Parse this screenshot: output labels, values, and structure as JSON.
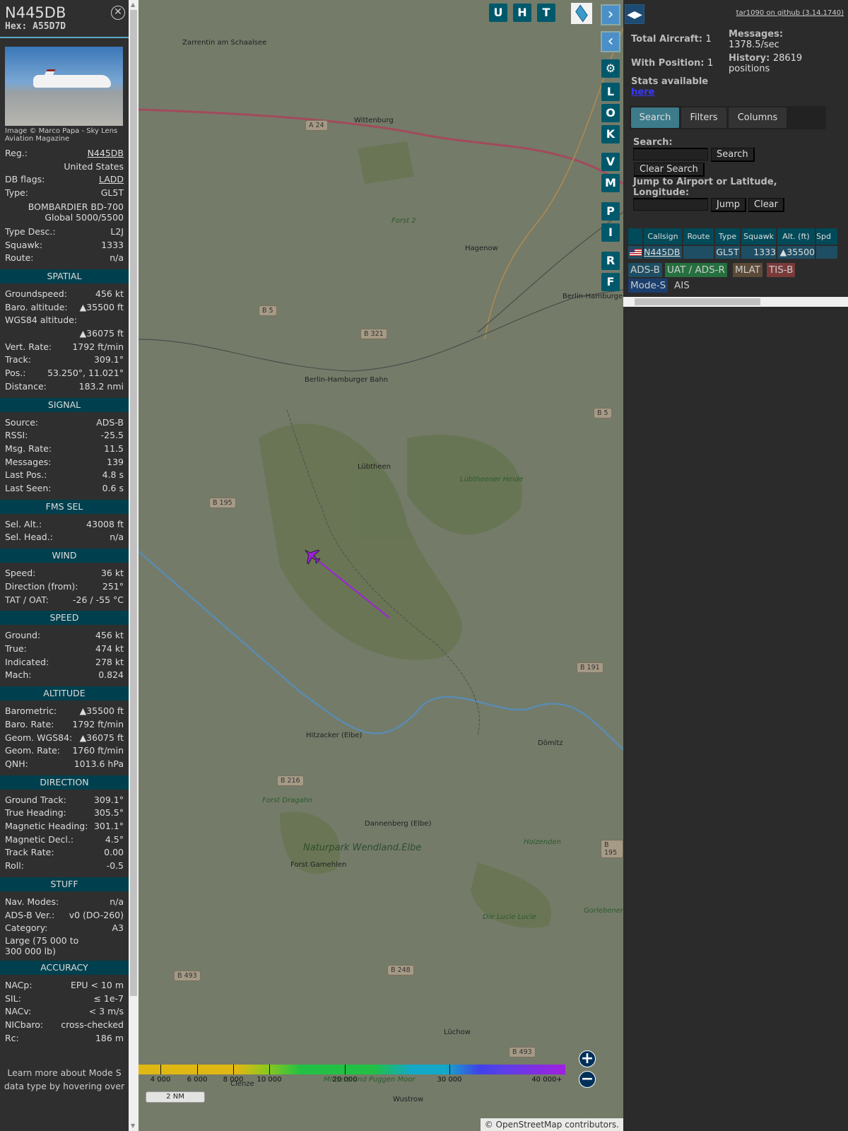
{
  "aircraft": {
    "registration": "N445DB",
    "hex_label": "Hex:",
    "hex": "A55D7D",
    "photo_credit": "Image © Marco Papa - Sky Lens Aviation Magazine"
  },
  "details": [
    {
      "label": "Reg.:",
      "value": "N445DB",
      "link": true
    },
    {
      "label": "",
      "value": "United States"
    },
    {
      "label": "DB flags:",
      "value": "LADD",
      "link": true
    },
    {
      "label": "Type:",
      "value": "GL5T"
    },
    {
      "label": "",
      "value": "BOMBARDIER BD-700 Global 5000/5500"
    },
    {
      "label": "Type Desc.:",
      "value": "L2J"
    },
    {
      "label": "Squawk:",
      "value": "1333"
    },
    {
      "label": "Route:",
      "value": "n/a"
    }
  ],
  "sections": [
    {
      "title": "SPATIAL",
      "rows": [
        [
          "Groundspeed:",
          "456 kt"
        ],
        [
          "Baro. altitude:",
          "▲35500 ft"
        ],
        [
          "WGS84 altitude:",
          ""
        ],
        [
          "",
          "▲36075 ft"
        ],
        [
          "Vert. Rate:",
          "1792 ft/min"
        ],
        [
          "Track:",
          "309.1°"
        ],
        [
          "Pos.:",
          "53.250°, 11.021°"
        ],
        [
          "Distance:",
          "183.2 nmi"
        ]
      ]
    },
    {
      "title": "SIGNAL",
      "rows": [
        [
          "Source:",
          "ADS-B"
        ],
        [
          "RSSI:",
          "-25.5"
        ],
        [
          "Msg. Rate:",
          "11.5"
        ],
        [
          "Messages:",
          "139"
        ],
        [
          "Last Pos.:",
          "4.8 s"
        ],
        [
          "Last Seen:",
          "0.6 s"
        ]
      ]
    },
    {
      "title": "FMS SEL",
      "rows": [
        [
          "Sel. Alt.:",
          "43008 ft"
        ],
        [
          "Sel. Head.:",
          "n/a"
        ]
      ]
    },
    {
      "title": "WIND",
      "rows": [
        [
          "Speed:",
          "36 kt"
        ],
        [
          "Direction (from):",
          "251°"
        ],
        [
          "TAT / OAT:",
          "-26 / -55 °C"
        ]
      ]
    },
    {
      "title": "SPEED",
      "rows": [
        [
          "Ground:",
          "456 kt"
        ],
        [
          "True:",
          "474 kt"
        ],
        [
          "Indicated:",
          "278 kt"
        ],
        [
          "Mach:",
          "0.824"
        ]
      ]
    },
    {
      "title": "ALTITUDE",
      "rows": [
        [
          "Barometric:",
          "▲35500 ft"
        ],
        [
          "Baro. Rate:",
          "1792 ft/min"
        ],
        [
          "Geom. WGS84:",
          "▲36075 ft"
        ],
        [
          "Geom. Rate:",
          "1760 ft/min"
        ],
        [
          "QNH:",
          "1013.6 hPa"
        ]
      ]
    },
    {
      "title": "DIRECTION",
      "rows": [
        [
          "Ground Track:",
          "309.1°"
        ],
        [
          "True Heading:",
          "305.5°"
        ],
        [
          "Magnetic Heading:",
          "301.1°"
        ],
        [
          "Magnetic Decl.:",
          "4.5°"
        ],
        [
          "Track Rate:",
          "0.00"
        ],
        [
          "Roll:",
          "-0.5"
        ]
      ]
    },
    {
      "title": "STUFF",
      "rows": [
        [
          "Nav. Modes:",
          "n/a"
        ],
        [
          "ADS-B Ver.:",
          "v0 (DO-260)"
        ],
        [
          "Category:",
          "A3"
        ],
        [
          "Large (75 000 to 300 000 lb)",
          ""
        ]
      ]
    },
    {
      "title": "ACCURACY",
      "rows": [
        [
          "NACp:",
          "EPU < 10 m"
        ],
        [
          "SIL:",
          "≤ 1e-7"
        ],
        [
          "NACv:",
          "< 3 m/s"
        ],
        [
          "NICbaro:",
          "cross-checked"
        ],
        [
          "Rc:",
          "186 m"
        ]
      ]
    }
  ],
  "learn_more": "Learn more about Mode S data type by hovering over",
  "map": {
    "top_buttons": [
      "U",
      "H",
      "T"
    ],
    "side_buttons": [
      "L",
      "O",
      "K",
      "V",
      "M",
      "P",
      "I",
      "R",
      "F"
    ],
    "labels": [
      "Zarrentin am Schaalsee",
      "Wittenburg",
      "Hagenow",
      "Lübtheen",
      "Lübtheener Heide",
      "Forst 2",
      "Hitzacker (Elbe)",
      "Dömitz",
      "Dannenberg (Elbe)",
      "Naturpark Wendland.Elbe",
      "Forst Gamehlen",
      "Forst Dragahn",
      "Holzenden",
      "Die Lucie Lucie",
      "Gorlebener Forst",
      "Lüchow",
      "Wustrow",
      "Mittlere und Puggen Moor",
      "Clenze",
      "Berlin-Hamburger Bahn",
      "Berlin-Hamburger B"
    ],
    "roads": [
      "A 24",
      "B 5",
      "B 321",
      "B 5",
      "B 195",
      "B 191",
      "B 216",
      "B 195",
      "B 493",
      "B 248",
      "B 493"
    ],
    "altitude_ticks": [
      "4 000",
      "6 000",
      "8 000",
      "10 000",
      "20 000",
      "30 000",
      "40 000+"
    ],
    "scale": "2 NM",
    "attribution_prefix": "©",
    "attribution_link": "OpenStreetMap",
    "attribution_suffix": "contributors."
  },
  "right": {
    "github": "tar1090 on github (3.14.1740)",
    "total_label": "Total Aircraft:",
    "total": "1",
    "withpos_label": "With Position:",
    "withpos": "1",
    "messages_label": "Messages:",
    "messages": "1378.5/sec",
    "history_label": "History:",
    "history": "28619 positions",
    "stats_label": "Stats available",
    "stats_link": "here",
    "tabs": [
      "Search",
      "Filters",
      "Columns"
    ],
    "search_label": "Search:",
    "search_btn": "Search",
    "clear_search_btn": "Clear Search",
    "jump_label": "Jump to Airport or Latitude, Longitude:",
    "jump_btn": "Jump",
    "clear_btn": "Clear",
    "columns": [
      "Callsign",
      "Route",
      "Type",
      "Squawk",
      "Alt. (ft)",
      "Spd"
    ],
    "row": {
      "callsign": "N445DB",
      "route": "",
      "type": "GL5T",
      "squawk": "1333",
      "alt": "▲35500"
    },
    "sources": [
      "ADS-B",
      "UAT / ADS-R",
      "MLAT",
      "TIS-B",
      "Mode-S",
      "AIS"
    ]
  },
  "colors": {
    "accent": "#00596b",
    "section": "#00404e",
    "track": "#a020e0"
  }
}
